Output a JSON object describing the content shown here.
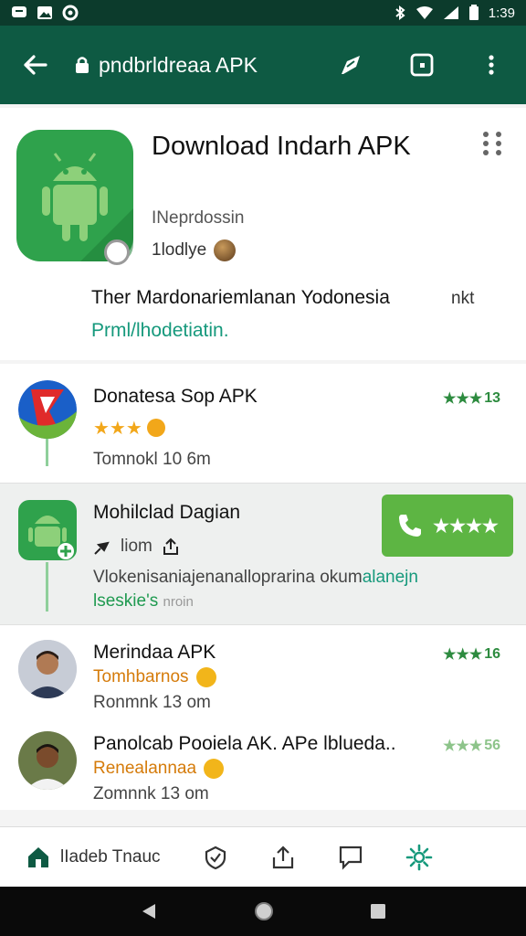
{
  "status_bar": {
    "left_icons": [
      "message-icon",
      "image-icon",
      "settings-icon"
    ],
    "right_icons": [
      "bluetooth-icon",
      "wifi-icon",
      "signal-icon",
      "battery-icon"
    ],
    "time": "1:39"
  },
  "toolbar": {
    "url": "pndbrldreaa APK"
  },
  "hero": {
    "title": "Download Indarh APK",
    "developer": "INeprdossin",
    "meta": "1lodlye",
    "description": "Ther Mardonariemlanan Yodonesia",
    "description_tail": "nkt",
    "link": "Prml/lhodetiatin."
  },
  "list": {
    "items": [
      {
        "title": "Donatesa Sop APK",
        "rating_stars": "★★★",
        "rating_value": "13",
        "sub_stars": "★★★",
        "sub": "Tomnokl 10 6m"
      },
      {
        "title": "Mohilclad Dagian",
        "sub_label": "liom",
        "desc_dark": "Vlokenisaniajenanalloprarina okum",
        "desc_teal": "alanejn",
        "desc_green": "lseskie's",
        "desc_gray": "nroin",
        "action_stars": "★★★★"
      },
      {
        "title": "Merindaa APK",
        "sub_accent": "Tomhbarnos",
        "sub": "Ronmnk 13 om",
        "rating_stars": "★★★",
        "rating_value": "16"
      },
      {
        "title": "Panolcab Pooiela AK. APe lblueda..",
        "sub_accent": "Renealannaa",
        "sub": "Zomnnk 13 om",
        "rating_stars": "★★★",
        "rating_value": "56"
      }
    ]
  },
  "bottom_nav": {
    "home_label": "lIadeb Tnauc"
  },
  "colors": {
    "toolbar": "#0e5a43",
    "status_bar": "#0c3b2c",
    "accent_green": "#5db543",
    "rating_green": "#2d8b3f",
    "link_teal": "#16997c"
  }
}
